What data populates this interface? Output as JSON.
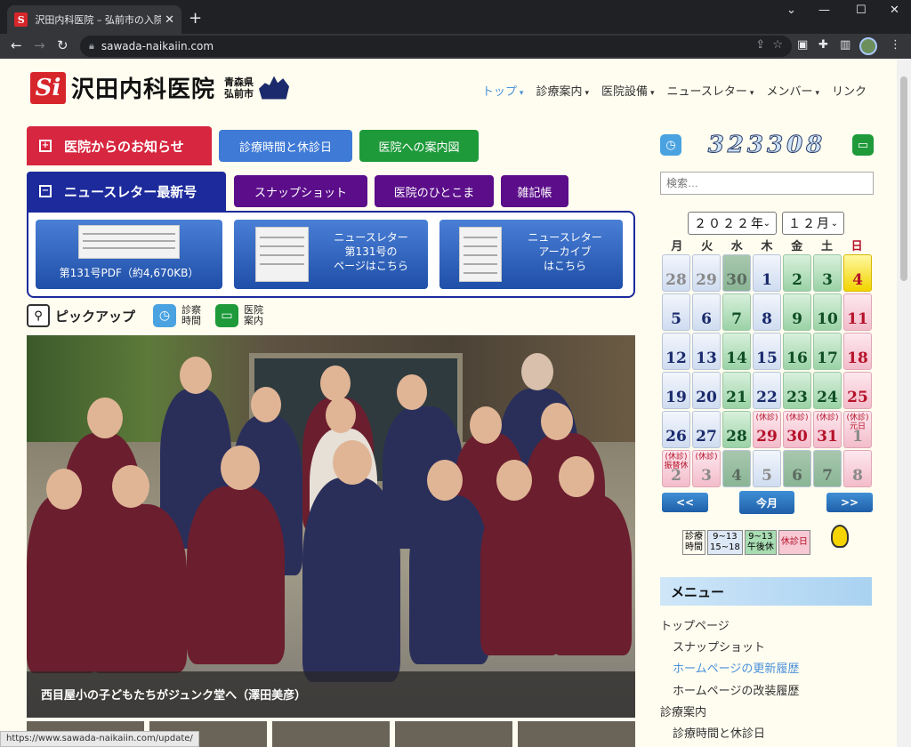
{
  "browser": {
    "tab_title": "沢田内科医院 – 弘前市の入院設備",
    "tab_close": "✕",
    "new_tab": "+",
    "url": "sawada-naikaiin.com",
    "status_url": "https://www.sawada-naikaiin.com/update/"
  },
  "header": {
    "logo_mark": "Si",
    "logo_name": "沢田内科医院",
    "location_line1": "青森県",
    "location_line2": "弘前市",
    "nav": [
      {
        "label": "トップ",
        "caret": "▾"
      },
      {
        "label": "診療案内",
        "caret": "▾"
      },
      {
        "label": "医院設備",
        "caret": "▾"
      },
      {
        "label": "ニュースレター",
        "caret": "▾"
      },
      {
        "label": "メンバー",
        "caret": "▾"
      },
      {
        "label": "リンク",
        "caret": ""
      }
    ]
  },
  "buttons": {
    "notice": "医院からのお知らせ",
    "hours": "診療時間と休診日",
    "map": "医院への案内図",
    "newsletter": "ニュースレター最新号",
    "snapshot": "スナップショット",
    "hitokoma": "医院のひとこま",
    "zakki": "雑記帳"
  },
  "newsletter": {
    "pdf": "第131号PDF（約4,670KB）",
    "page_l1": "ニュースレター",
    "page_l2": "第131号の",
    "page_l3": "ページはこちら",
    "arch_l1": "ニュースレター",
    "arch_l2": "アーカイブ",
    "arch_l3": "はこちら"
  },
  "pickup": {
    "label": "ピックアップ",
    "hours_l1": "診察",
    "hours_l2": "時間",
    "guide_l1": "医院",
    "guide_l2": "案内"
  },
  "photo": {
    "caption": "西目屋小の子どもたちがジュンク堂へ（澤田美彦）"
  },
  "sidebar": {
    "counter": "323308",
    "search_placeholder": "検索…",
    "year": "２０２２年",
    "month": "１２月",
    "weekdays": [
      "月",
      "火",
      "水",
      "木",
      "金",
      "土",
      "日"
    ],
    "days": [
      {
        "n": "28",
        "c": "b prev",
        "t": ""
      },
      {
        "n": "29",
        "c": "b prev",
        "t": ""
      },
      {
        "n": "30",
        "c": "prevg",
        "t": ""
      },
      {
        "n": "1",
        "c": "b",
        "t": ""
      },
      {
        "n": "2",
        "c": "g",
        "t": ""
      },
      {
        "n": "3",
        "c": "g",
        "t": ""
      },
      {
        "n": "4",
        "c": "y",
        "t": ""
      },
      {
        "n": "5",
        "c": "b",
        "t": ""
      },
      {
        "n": "6",
        "c": "b",
        "t": ""
      },
      {
        "n": "7",
        "c": "g",
        "t": ""
      },
      {
        "n": "8",
        "c": "b",
        "t": ""
      },
      {
        "n": "9",
        "c": "g",
        "t": ""
      },
      {
        "n": "10",
        "c": "g",
        "t": ""
      },
      {
        "n": "11",
        "c": "p",
        "t": ""
      },
      {
        "n": "12",
        "c": "b",
        "t": ""
      },
      {
        "n": "13",
        "c": "b",
        "t": ""
      },
      {
        "n": "14",
        "c": "g",
        "t": ""
      },
      {
        "n": "15",
        "c": "b",
        "t": ""
      },
      {
        "n": "16",
        "c": "g",
        "t": ""
      },
      {
        "n": "17",
        "c": "g",
        "t": ""
      },
      {
        "n": "18",
        "c": "p",
        "t": ""
      },
      {
        "n": "19",
        "c": "b",
        "t": ""
      },
      {
        "n": "20",
        "c": "b",
        "t": ""
      },
      {
        "n": "21",
        "c": "g",
        "t": ""
      },
      {
        "n": "22",
        "c": "b",
        "t": ""
      },
      {
        "n": "23",
        "c": "g",
        "t": ""
      },
      {
        "n": "24",
        "c": "g",
        "t": ""
      },
      {
        "n": "25",
        "c": "p",
        "t": ""
      },
      {
        "n": "26",
        "c": "b",
        "t": ""
      },
      {
        "n": "27",
        "c": "b",
        "t": ""
      },
      {
        "n": "28",
        "c": "g",
        "t": ""
      },
      {
        "n": "29",
        "c": "p",
        "t": "(休診)"
      },
      {
        "n": "30",
        "c": "p",
        "t": "(休診)"
      },
      {
        "n": "31",
        "c": "p",
        "t": "(休診)"
      },
      {
        "n": "1",
        "c": "p prev",
        "t": "(休診)元日"
      },
      {
        "n": "2",
        "c": "p prev",
        "t": "(休診)振替休"
      },
      {
        "n": "3",
        "c": "p prev",
        "t": "(休診)"
      },
      {
        "n": "4",
        "c": "prevg",
        "t": ""
      },
      {
        "n": "5",
        "c": "b prev",
        "t": ""
      },
      {
        "n": "6",
        "c": "prevg",
        "t": ""
      },
      {
        "n": "7",
        "c": "prevg",
        "t": ""
      },
      {
        "n": "8",
        "c": "p prev",
        "t": ""
      }
    ],
    "prev": "<<",
    "today": "今月",
    "next": ">>",
    "legend": {
      "time_l1": "診療",
      "time_l2": "時間",
      "b_l1": "9~13",
      "b_l2": "15~18",
      "g_l1": "9~13",
      "g_l2": "午後休",
      "p": "休診日"
    },
    "menu_title": "メニュー",
    "menu": [
      "トップページ",
      "スナップショット",
      "ホームページの更新履歴",
      "ホームページの改装履歴",
      "診療案内",
      "診療時間と休診日"
    ]
  }
}
